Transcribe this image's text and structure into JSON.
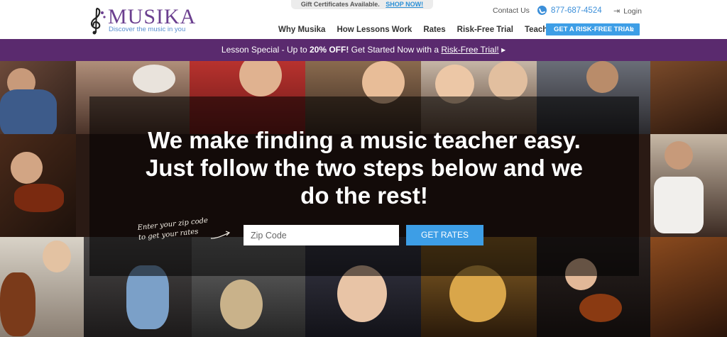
{
  "header": {
    "gift_text": "Gift Certificates Available.",
    "gift_link": "SHOP NOW!",
    "logo_word": "MUSIKA",
    "logo_tagline": "Discover the music in you",
    "contact": "Contact Us",
    "phone": "877-687-4524",
    "login": "Login",
    "nav": [
      "Why Musika",
      "How Lessons Work",
      "Rates",
      "Risk-Free Trial",
      "Teachers"
    ],
    "cta": "GET A RISK-FREE TRIAL"
  },
  "promo": {
    "pre": "Lesson Special - Up to ",
    "bold": "20% OFF!",
    "mid": " Get Started Now with a ",
    "link": "Risk-Free Trial!",
    "arrow": "▸"
  },
  "hero": {
    "headline_line1": "We make finding a music teacher easy.",
    "headline_line2": "Just follow the two steps below and we",
    "headline_line3": "do the rest!",
    "hint_line1": "Enter your zip code",
    "hint_line2": "to get your rates",
    "zip_placeholder": "Zip Code",
    "button": "GET RATES"
  },
  "colors": {
    "brand_purple": "#6b3f8f",
    "promo_bg": "#5a2a6e",
    "accent_blue": "#3d9ee6"
  },
  "icons": {
    "phone": "phone-icon",
    "login": "login-icon",
    "cta_chevron": "chevron-right-icon",
    "logo": "treble-clef-icon"
  }
}
